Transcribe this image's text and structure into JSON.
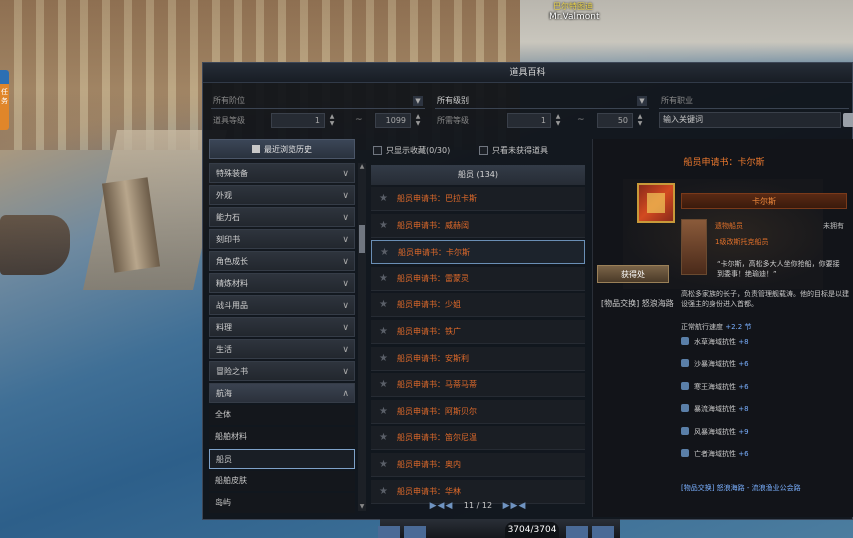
{
  "world": {
    "npc_guild": "巴尔特图迪",
    "npc_name": "Mr.Valmont",
    "left_tab_label": "任务"
  },
  "window": {
    "title": "道具百科",
    "filters": {
      "tier_placeholder": "所有阶位",
      "grade_value": "所有级别",
      "class_placeholder": "所有职业",
      "item_level_label": "道具等级",
      "item_level_min": "1",
      "item_level_max": "1099",
      "required_level_label": "所需等级",
      "required_level_min": "1",
      "required_level_max": "50",
      "search_placeholder": "输入关键词"
    },
    "categories": {
      "history_button": "最近浏览历史",
      "items": [
        {
          "label": "特殊装备",
          "state": "collapsed"
        },
        {
          "label": "外观",
          "state": "collapsed"
        },
        {
          "label": "能力石",
          "state": "collapsed"
        },
        {
          "label": "刻印书",
          "state": "collapsed"
        },
        {
          "label": "角色成长",
          "state": "collapsed"
        },
        {
          "label": "精炼材料",
          "state": "collapsed"
        },
        {
          "label": "战斗用品",
          "state": "collapsed"
        },
        {
          "label": "料理",
          "state": "collapsed"
        },
        {
          "label": "生活",
          "state": "collapsed"
        },
        {
          "label": "冒险之书",
          "state": "collapsed"
        },
        {
          "label": "航海",
          "state": "expanded"
        }
      ],
      "subitems": [
        {
          "label": "全体"
        },
        {
          "label": "船舶材料"
        },
        {
          "label": "船员",
          "selected": true
        },
        {
          "label": "船舶皮肤"
        },
        {
          "label": "岛屿"
        }
      ]
    },
    "list": {
      "only_favorites_label": "只显示收藏(0/30)",
      "only_unobtained_label": "只看未获得道具",
      "header": "船员 (134)",
      "items": [
        "船员申请书：巴拉卡斯",
        "船员申请书：威赫阔",
        "船员申请书：卡尔斯",
        "船员申请书：雷蒙灵",
        "船员申请书：少姐",
        "船员申请书：铁广",
        "船员申请书：安斯利",
        "船员申请书：马蒂马蒂",
        "船员申请书：阿斯贝尔",
        "船员申请书：笛尔尼温",
        "船员申请书：奥内",
        "船员申请书：华林"
      ],
      "selected_index": 2,
      "page_current": "11",
      "page_total": "12",
      "page_label": "11 / 12"
    },
    "detail": {
      "title": "船员申请书：卡尔斯",
      "card_name": "卡尔斯",
      "rank": "遗物船员",
      "owned": "未拥有",
      "origin": "1级改斯托克船员",
      "quote": "“卡尔斯，高松多大人坐你抢船，你要接到委事！绝瑜迪！”",
      "get_button": "获得处",
      "source": "[物品交换] 怒浪海路",
      "desc": "高松多家族的长子，负责管理舰载涛。他的目标是以建设强主的身份进入首都。",
      "speed_label": "正常航行速度",
      "speed_value": "+2.2 节",
      "resistances": [
        {
          "label": "水草海域抗性",
          "value": "+8"
        },
        {
          "label": "沙暴海域抗性",
          "value": "+6"
        },
        {
          "label": "寒王海域抗性",
          "value": "+6"
        },
        {
          "label": "暴流海域抗性",
          "value": "+8"
        },
        {
          "label": "风暴海域抗性",
          "value": "+9"
        },
        {
          "label": "亡者海域抗性",
          "value": "+6"
        }
      ],
      "link": "[物品交换] 怒浪海路 - 流浪渔业公会路"
    }
  },
  "hud": {
    "hp": "3704/3704"
  },
  "colors": {
    "accent_orange": "#ef7a2e",
    "stat_blue": "#7ab0ff",
    "selection_border": "#6a8fb6"
  }
}
